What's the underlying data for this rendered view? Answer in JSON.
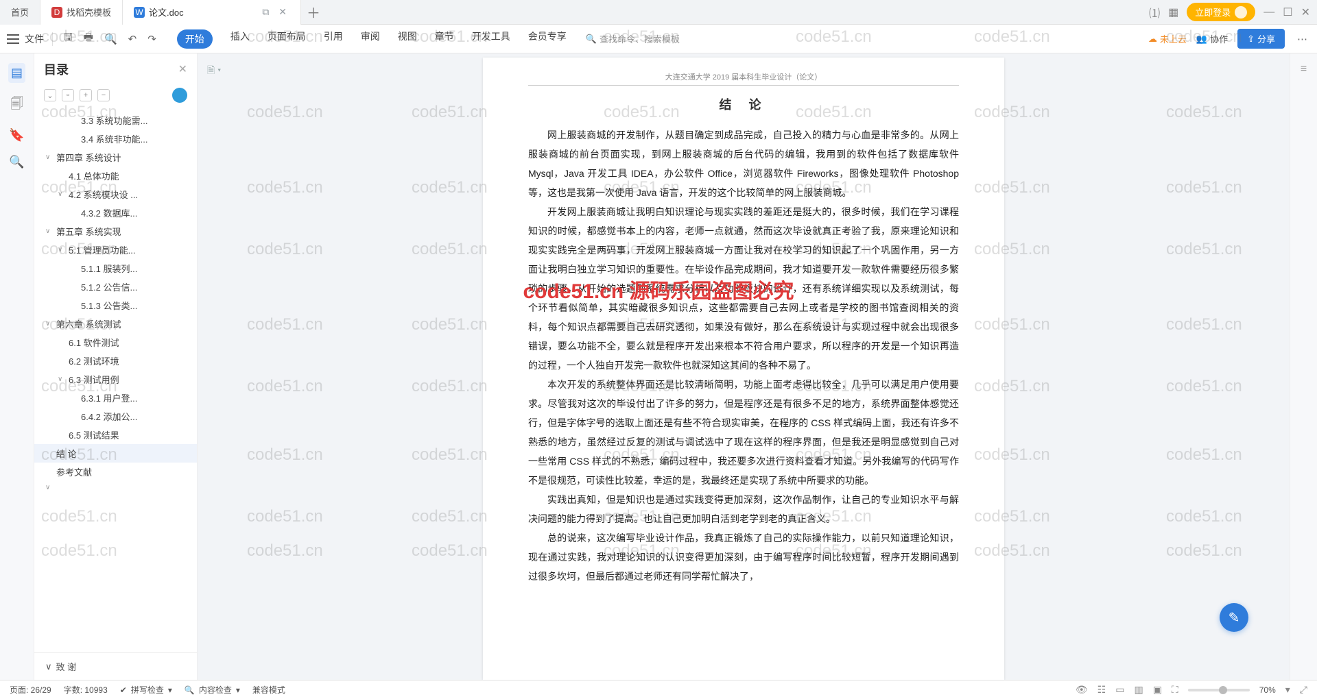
{
  "tabs": {
    "home": "首页",
    "tpl": "找稻壳模板",
    "doc": "论文.doc"
  },
  "login_btn": "立即登录",
  "ribbon": {
    "file": "文件",
    "menus": [
      "开始",
      "插入",
      "页面布局",
      "引用",
      "审阅",
      "视图",
      "章节",
      "开发工具",
      "会员专享"
    ],
    "search_placeholder": "查找命令、搜索模板",
    "cloud": "未上云",
    "collab": "协作",
    "share": "分享"
  },
  "outline": {
    "title": "目录",
    "items": [
      {
        "lvl": 3,
        "txt": "3.3 系统功能需..."
      },
      {
        "lvl": 3,
        "txt": "3.4 系统非功能..."
      },
      {
        "lvl": 1,
        "txt": "第四章  系统设计",
        "chev": "∨"
      },
      {
        "lvl": 2,
        "txt": "4.1 总体功能"
      },
      {
        "lvl": 2,
        "txt": "4.2  系统模块设 ...",
        "chev": "∨"
      },
      {
        "lvl": 3,
        "txt": "4.3.2 数据库..."
      },
      {
        "lvl": 1,
        "txt": "第五章  系统实现",
        "chev": "∨"
      },
      {
        "lvl": 2,
        "txt": "5.1 管理员功能...",
        "chev": "∨"
      },
      {
        "lvl": 3,
        "txt": "5.1.1 服装列..."
      },
      {
        "lvl": 3,
        "txt": "5.1.2 公告信..."
      },
      {
        "lvl": 3,
        "txt": "5.1.3 公告类..."
      },
      {
        "lvl": 1,
        "txt": "第六章  系统测试",
        "chev": "∨"
      },
      {
        "lvl": 2,
        "txt": "6.1 软件测试"
      },
      {
        "lvl": 2,
        "txt": "6.2 测试环境"
      },
      {
        "lvl": 2,
        "txt": "6.3 测试用例",
        "chev": "∨"
      },
      {
        "lvl": 3,
        "txt": "6.3.1 用户登..."
      },
      {
        "lvl": 3,
        "txt": "6.4.2 添加公..."
      },
      {
        "lvl": 2,
        "txt": "6.5 测试结果"
      },
      {
        "lvl": 1,
        "txt": "结    论",
        "sel": true
      },
      {
        "lvl": 1,
        "txt": "参考文献"
      },
      {
        "lvl": 1,
        "txt": "",
        "chev": "∨"
      }
    ],
    "footer": "致    谢"
  },
  "doc": {
    "header": "大连交通大学 2019 届本科生毕业设计（论文）",
    "title": "结    论",
    "p1": "网上服装商城的开发制作，从题目确定到成品完成，自己投入的精力与心血是非常多的。从网上服装商城的前台页面实现，到网上服装商城的后台代码的编辑，我用到的软件包括了数据库软件 Mysql，Java 开发工具 IDEA，办公软件 Office，浏览器软件 Fireworks，图像处理软件 Photoshop 等，这也是我第一次使用 Java 语言，开发的这个比较简单的网上服装商城。",
    "p2": "开发网上服装商城让我明白知识理论与现实实践的差距还是挺大的，很多时候，我们在学习课程知识的时候，都感觉书本上的内容，老师一点就通，然而这次毕设就真正考验了我，原来理论知识和现实实践完全是两码事，开发网上服装商城一方面让我对在校学习的知识起了一个巩固作用，另一方面让我明白独立学习知识的重要性。在毕设作品完成期间，我才知道要开发一款软件需要经历很多繁琐的步骤，从开始的选题到系统需求分析以及功能板块的设计，还有系统详细实现以及系统测试，每个环节看似简单，其实暗藏很多知识点，这些都需要自己去网上或者是学校的图书馆查阅相关的资料，每个知识点都需要自己去研究透彻，如果没有做好，那么在系统设计与实现过程中就会出现很多错误，要么功能不全，要么就是程序开发出来根本不符合用户要求，所以程序的开发是一个知识再造的过程，一个人独自开发完一款软件也就深知这其间的各种不易了。",
    "p3": "本次开发的系统整体界面还是比较清晰简明，功能上面考虑得比较全，几乎可以满足用户使用要求。尽管我对这次的毕设付出了许多的努力，但是程序还是有很多不足的地方，系统界面整体感觉还行，但是字体字号的选取上面还是有些不符合现实审美，在程序的 CSS 样式编码上面，我还有许多不熟悉的地方，虽然经过反复的测试与调试选中了现在这样的程序界面，但是我还是明显感觉到自己对一些常用 CSS 样式的不熟悉，编码过程中，我还要多次进行资料查看才知道。另外我编写的代码写作不是很规范，可读性比较差，幸运的是，我最终还是实现了系统中所要求的功能。",
    "p4": "实践出真知，但是知识也是通过实践变得更加深刻，这次作品制作，让自己的专业知识水平与解决问题的能力得到了提高。也让自己更加明白活到老学到老的真正含义。",
    "p5": "总的说来，这次编写毕业设计作品，我真正锻炼了自己的实际操作能力，以前只知道理论知识，现在通过实践，我对理论知识的认识变得更加深刻，由于编写程序时间比较短暂，程序开发期间遇到过很多坎坷，但最后都通过老师还有同学帮忙解决了，"
  },
  "status": {
    "page": "页面: 26/29",
    "words": "字数: 10993",
    "spell": "拼写检查",
    "content": "内容检查",
    "compat": "兼容模式",
    "zoom": "70%"
  },
  "watermark": "code51.cn",
  "watermark_center": "code51.cn  源码乐园盗图必究"
}
